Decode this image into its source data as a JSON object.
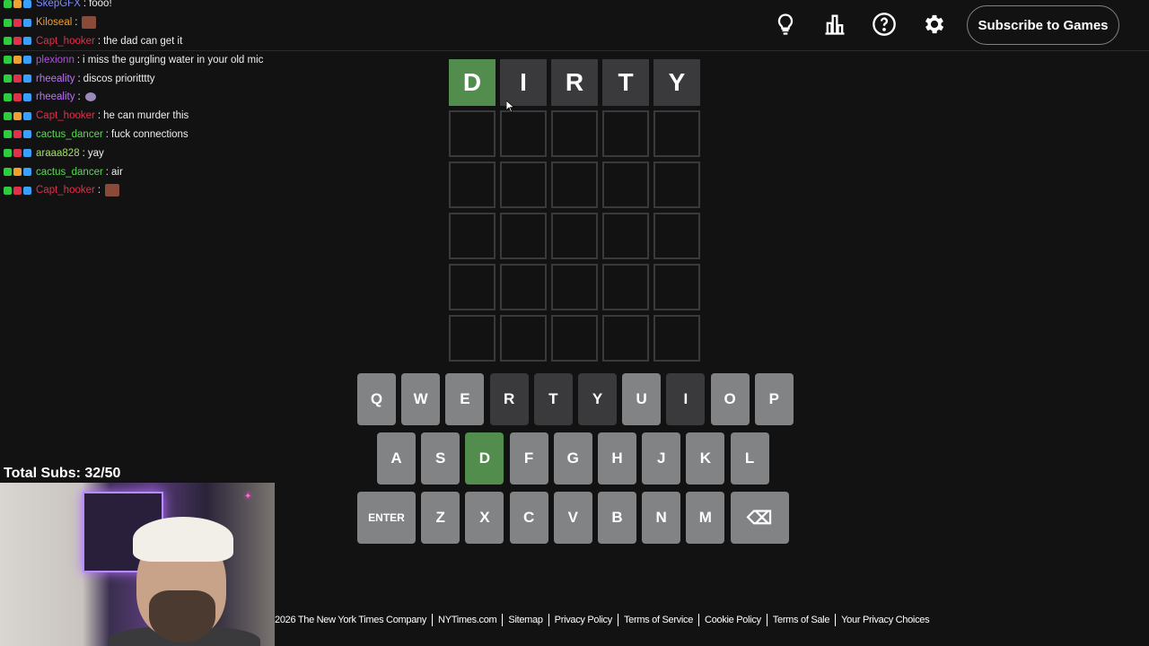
{
  "colors": {
    "background": "#121213",
    "correct": "#538d4e",
    "absent": "#3a3a3c",
    "key_default": "#818384",
    "tile_border": "#3a3a3c"
  },
  "header": {
    "subscribe_label": "Subscribe to Games",
    "icons": [
      "lightbulb-icon",
      "stats-icon",
      "help-icon",
      "settings-icon"
    ]
  },
  "chat": [
    {
      "user": "SkepGFX",
      "color": "#7c8cff",
      "message": "fooo!",
      "emote": ""
    },
    {
      "user": "Kiloseal",
      "color": "#f0a030",
      "message": "",
      "emote": "brown"
    },
    {
      "user": "Capt_hooker",
      "color": "#e0304a",
      "message": "the dad can get it",
      "emote": ""
    },
    {
      "user": "plexionn",
      "color": "#b050e0",
      "message": "i miss the gurgling water in your old mic",
      "emote": ""
    },
    {
      "user": "rheeality",
      "color": "#c070ff",
      "message": "discos prioritttty",
      "emote": ""
    },
    {
      "user": "rheeality",
      "color": "#c070ff",
      "message": "",
      "emote": "purple"
    },
    {
      "user": "Capt_hooker",
      "color": "#e0304a",
      "message": "he can murder this",
      "emote": ""
    },
    {
      "user": "cactus_dancer",
      "color": "#5adc50",
      "message": "fuck connections",
      "emote": ""
    },
    {
      "user": "araaa828",
      "color": "#a0e060",
      "message": "yay",
      "emote": ""
    },
    {
      "user": "cactus_dancer",
      "color": "#5adc50",
      "message": "air",
      "emote": ""
    },
    {
      "user": "Capt_hooker",
      "color": "#e0304a",
      "message": "",
      "emote": "brown"
    }
  ],
  "board": {
    "rows": [
      [
        {
          "letter": "D",
          "state": "correct"
        },
        {
          "letter": "I",
          "state": "absent"
        },
        {
          "letter": "R",
          "state": "absent"
        },
        {
          "letter": "T",
          "state": "absent"
        },
        {
          "letter": "Y",
          "state": "absent"
        }
      ],
      [
        {
          "letter": "",
          "state": "empty"
        },
        {
          "letter": "",
          "state": "empty"
        },
        {
          "letter": "",
          "state": "empty"
        },
        {
          "letter": "",
          "state": "empty"
        },
        {
          "letter": "",
          "state": "empty"
        }
      ],
      [
        {
          "letter": "",
          "state": "empty"
        },
        {
          "letter": "",
          "state": "empty"
        },
        {
          "letter": "",
          "state": "empty"
        },
        {
          "letter": "",
          "state": "empty"
        },
        {
          "letter": "",
          "state": "empty"
        }
      ],
      [
        {
          "letter": "",
          "state": "empty"
        },
        {
          "letter": "",
          "state": "empty"
        },
        {
          "letter": "",
          "state": "empty"
        },
        {
          "letter": "",
          "state": "empty"
        },
        {
          "letter": "",
          "state": "empty"
        }
      ],
      [
        {
          "letter": "",
          "state": "empty"
        },
        {
          "letter": "",
          "state": "empty"
        },
        {
          "letter": "",
          "state": "empty"
        },
        {
          "letter": "",
          "state": "empty"
        },
        {
          "letter": "",
          "state": "empty"
        }
      ],
      [
        {
          "letter": "",
          "state": "empty"
        },
        {
          "letter": "",
          "state": "empty"
        },
        {
          "letter": "",
          "state": "empty"
        },
        {
          "letter": "",
          "state": "empty"
        },
        {
          "letter": "",
          "state": "empty"
        }
      ]
    ]
  },
  "keyboard": {
    "rows": [
      [
        {
          "label": "Q",
          "state": "default"
        },
        {
          "label": "W",
          "state": "default"
        },
        {
          "label": "E",
          "state": "default"
        },
        {
          "label": "R",
          "state": "absent"
        },
        {
          "label": "T",
          "state": "absent"
        },
        {
          "label": "Y",
          "state": "absent"
        },
        {
          "label": "U",
          "state": "default"
        },
        {
          "label": "I",
          "state": "absent"
        },
        {
          "label": "O",
          "state": "default"
        },
        {
          "label": "P",
          "state": "default"
        }
      ],
      [
        {
          "label": "A",
          "state": "default"
        },
        {
          "label": "S",
          "state": "default"
        },
        {
          "label": "D",
          "state": "correct"
        },
        {
          "label": "F",
          "state": "default"
        },
        {
          "label": "G",
          "state": "default"
        },
        {
          "label": "H",
          "state": "default"
        },
        {
          "label": "J",
          "state": "default"
        },
        {
          "label": "K",
          "state": "default"
        },
        {
          "label": "L",
          "state": "default"
        }
      ],
      [
        {
          "label": "ENTER",
          "state": "default"
        },
        {
          "label": "Z",
          "state": "default"
        },
        {
          "label": "X",
          "state": "default"
        },
        {
          "label": "C",
          "state": "default"
        },
        {
          "label": "V",
          "state": "default"
        },
        {
          "label": "B",
          "state": "default"
        },
        {
          "label": "N",
          "state": "default"
        },
        {
          "label": "M",
          "state": "default"
        },
        {
          "label": "⌫",
          "state": "default"
        }
      ]
    ]
  },
  "overlay": {
    "subs_label": "Total Subs: 32/50"
  },
  "footer": {
    "copyright": "2026 The New York Times Company",
    "links": [
      "NYTimes.com",
      "Sitemap",
      "Privacy Policy",
      "Terms of Service",
      "Cookie Policy",
      "Terms of Sale",
      "Your Privacy Choices"
    ]
  }
}
